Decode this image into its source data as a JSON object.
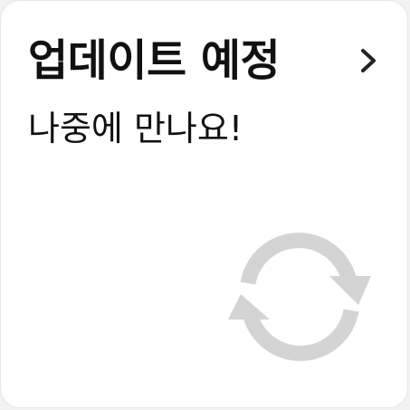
{
  "card": {
    "title": "업데이트 예정",
    "subtitle": "나중에 만나요!",
    "chevron_icon": "chevron-right-icon",
    "sync_icon": "refresh-icon"
  },
  "colors": {
    "background": "#ffffff",
    "text": "#111111",
    "icon": "#d4d4d4"
  }
}
